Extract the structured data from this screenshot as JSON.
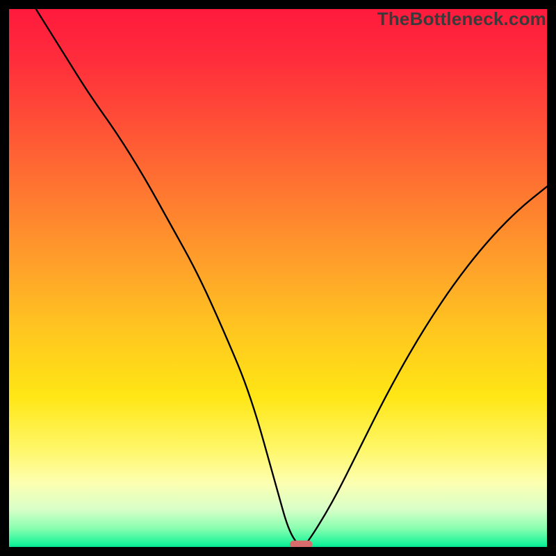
{
  "watermark": "TheBottleneck.com",
  "chart_data": {
    "type": "line",
    "title": "",
    "xlabel": "",
    "ylabel": "",
    "xlim": [
      0,
      100
    ],
    "ylim": [
      0,
      100
    ],
    "gradient_stops": [
      {
        "offset": 0.0,
        "color": "#ff1a3d"
      },
      {
        "offset": 0.1,
        "color": "#ff2e3b"
      },
      {
        "offset": 0.22,
        "color": "#ff5236"
      },
      {
        "offset": 0.35,
        "color": "#ff7a30"
      },
      {
        "offset": 0.48,
        "color": "#ffa22a"
      },
      {
        "offset": 0.6,
        "color": "#ffc71f"
      },
      {
        "offset": 0.72,
        "color": "#ffe615"
      },
      {
        "offset": 0.82,
        "color": "#fff76a"
      },
      {
        "offset": 0.88,
        "color": "#fdffb0"
      },
      {
        "offset": 0.93,
        "color": "#d8ffc8"
      },
      {
        "offset": 0.965,
        "color": "#8affb0"
      },
      {
        "offset": 0.995,
        "color": "#18f39a"
      },
      {
        "offset": 1.0,
        "color": "#0adf90"
      }
    ],
    "series": [
      {
        "name": "bottleneck-curve",
        "x": [
          5,
          10,
          15,
          20,
          25,
          30,
          35,
          40,
          45,
          50,
          52,
          54,
          55,
          60,
          65,
          70,
          75,
          80,
          85,
          90,
          95,
          100
        ],
        "y": [
          100,
          92,
          84,
          77,
          69,
          60,
          51,
          40,
          28,
          10,
          3,
          0,
          0,
          8,
          18,
          28,
          37,
          45,
          52,
          58,
          63,
          67
        ]
      }
    ],
    "marker": {
      "name": "optimal-point",
      "x": 54.3,
      "y": 0.5,
      "width": 4.2,
      "height": 1.4,
      "color": "#d86b6b"
    }
  }
}
